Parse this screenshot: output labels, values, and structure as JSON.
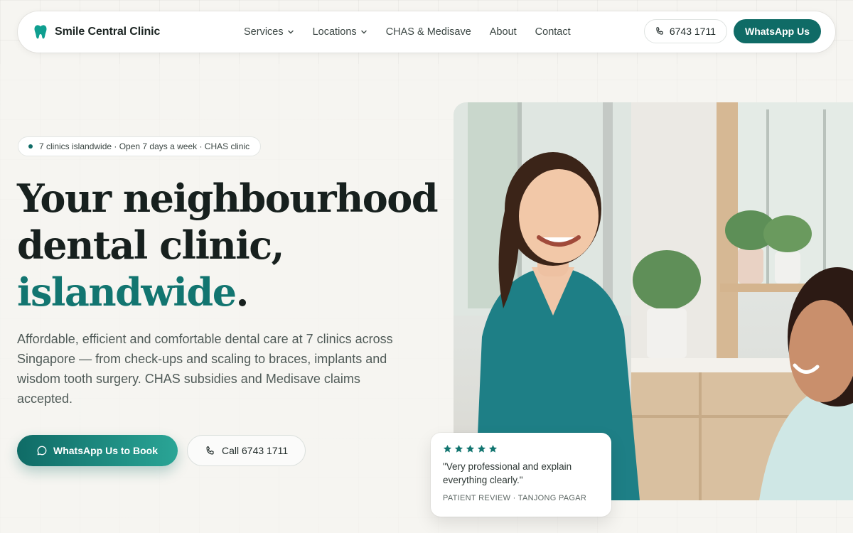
{
  "brand": {
    "name": "Smile Central Clinic",
    "icon": "tooth-icon",
    "color": "#0f6b66"
  },
  "nav": {
    "items": [
      {
        "label": "Services",
        "dropdown": true
      },
      {
        "label": "Locations",
        "dropdown": true
      },
      {
        "label": "CHAS & Medisave",
        "dropdown": false
      },
      {
        "label": "About",
        "dropdown": false
      },
      {
        "label": "Contact",
        "dropdown": false
      }
    ],
    "phone_label": "6743 1711",
    "whatsapp_label": "WhatsApp Us"
  },
  "hero": {
    "pill_text": "7 clinics islandwide · Open 7 days a week · CHAS clinic",
    "headline_line1": "Your neighbourhood",
    "headline_line2": "dental clinic,",
    "headline_accent": "islandwide",
    "headline_period": ".",
    "lede": "Affordable, efficient and comfortable dental care at 7 clinics across Singapore — from check-ups and scaling to braces, implants and wisdom tooth surgery. CHAS subsidies and Medisave claims accepted.",
    "cta_whatsapp": "WhatsApp Us to Book",
    "cta_call": "Call 6743 1711"
  },
  "review": {
    "stars": 5,
    "quote": "\"Very professional and explain everything clearly.\"",
    "source": "PATIENT REVIEW · TANJONG PAGAR"
  },
  "colors": {
    "accent": "#0f6b66",
    "accent_light": "#2aa596",
    "star": "#127570",
    "background": "#f6f5f1"
  }
}
